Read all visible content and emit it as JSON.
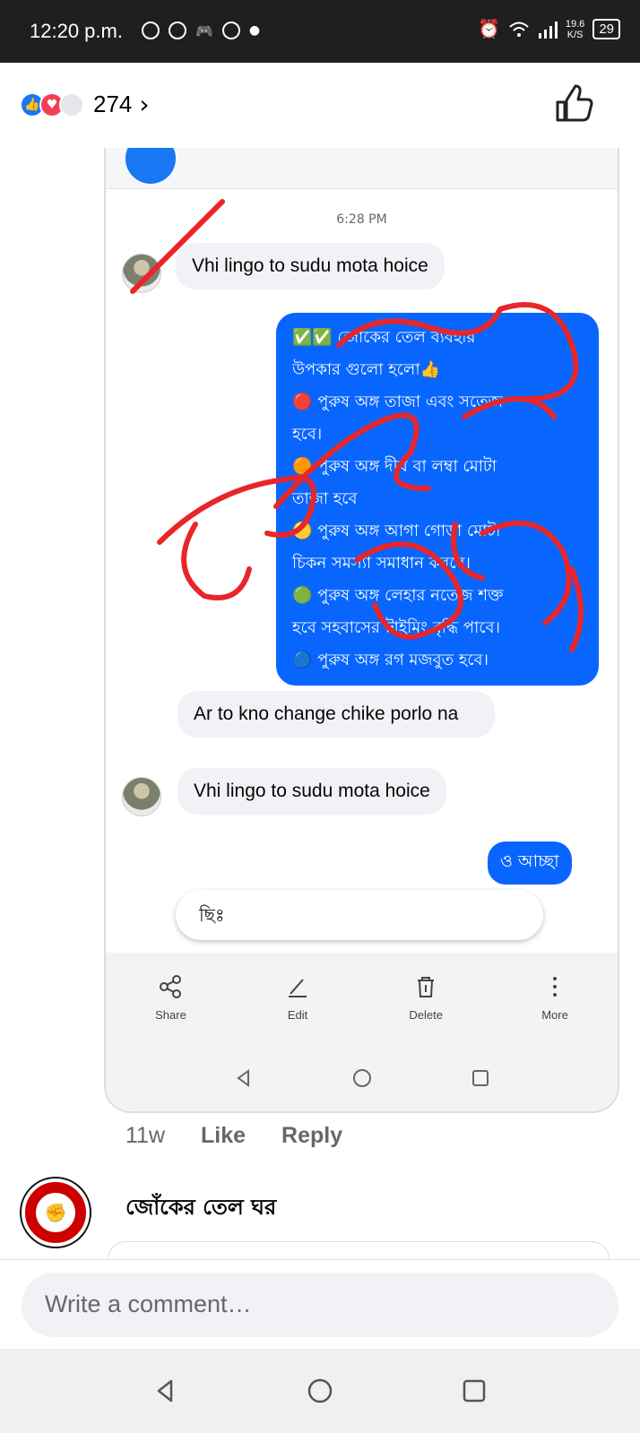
{
  "status_bar": {
    "time": "12:20 p.m.",
    "speed": "19.6\nK/S",
    "battery": "29"
  },
  "reactions": {
    "count": "274"
  },
  "chat": {
    "timestamp": "6:28 PM",
    "msg1": "Vhi lingo to sudu mota hoice",
    "promo_lines": [
      "✅✅ জোঁকের তেল ব্যবহার",
      "উপকার গুলো হলো👍",
      "🔴 পুরুষ অঙ্গ তাজা এবং সতেজ",
      "হবে।",
      "🟠 পুরুষ অঙ্গ দীর্ঘ বা লম্বা মোটা",
      "তাজা হবে",
      "🟡 পুরুষ অঙ্গ আগা গোড়া মোটা",
      "চিকন সমস্যা সমাধান করবে।",
      "🟢 পুরুষ অঙ্গ লেহার নতেজ শক্ত",
      "হবে সহবাসের টাইমিং বৃদ্ধি পাবে।",
      "🔵 পুরুষ অঙ্গ রগ মজবুত হবে।"
    ],
    "msg2": "Ar to kno change chike porlo na",
    "msg3": "Vhi lingo to sudu mota hoice",
    "reply_small": "ও আচ্ছা",
    "input_text": "ছিঃ",
    "toolbar": {
      "share": "Share",
      "edit": "Edit",
      "delete": "Delete",
      "more": "More"
    }
  },
  "comment_meta": {
    "age": "11w",
    "like": "Like",
    "reply": "Reply"
  },
  "reply_author": "জোঁকের তেল ঘর",
  "write_placeholder": "Write a comment…",
  "colors": {
    "messenger_blue": "#0866ff",
    "fb_blue": "#1877f2",
    "scribble_red": "#e8262a"
  }
}
